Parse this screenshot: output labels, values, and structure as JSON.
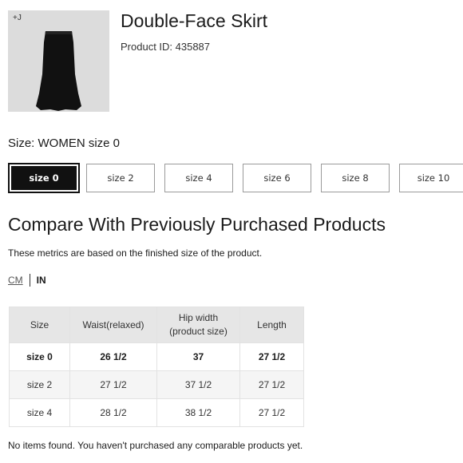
{
  "product": {
    "badge": "+J",
    "title": "Double-Face Skirt",
    "product_id": "Product ID: 435887"
  },
  "size_selector": {
    "label": "Size: WOMEN size 0",
    "options": [
      "size 0",
      "size 2",
      "size 4",
      "size 6",
      "size 8",
      "size 10"
    ],
    "selected": "size 0"
  },
  "compare": {
    "title": "Compare With Previously Purchased Products",
    "note": "These metrics are based on the finished size of the product.",
    "units": {
      "cm": "CM",
      "in": "IN",
      "active": "IN"
    },
    "table": {
      "headers": [
        "Size",
        "Waist(relaxed)",
        "Hip width\n(product size)",
        "Length"
      ],
      "header_lines": {
        "size": "Size",
        "waist": "Waist(relaxed)",
        "hip_line1": "Hip width",
        "hip_line2": "(product size)",
        "length": "Length"
      },
      "rows": [
        {
          "size": "size 0",
          "waist": "26 1/2",
          "hip": "37",
          "length": "27 1/2"
        },
        {
          "size": "size 2",
          "waist": "27 1/2",
          "hip": "37 1/2",
          "length": "27 1/2"
        },
        {
          "size": "size 4",
          "waist": "28 1/2",
          "hip": "38 1/2",
          "length": "27 1/2"
        }
      ]
    },
    "empty_message": "No items found. You haven't purchased any comparable products yet."
  },
  "colors": {
    "selected_bg": "#111111",
    "header_bg": "#e6e6e6",
    "thumb_bg": "#dcdcdc"
  }
}
